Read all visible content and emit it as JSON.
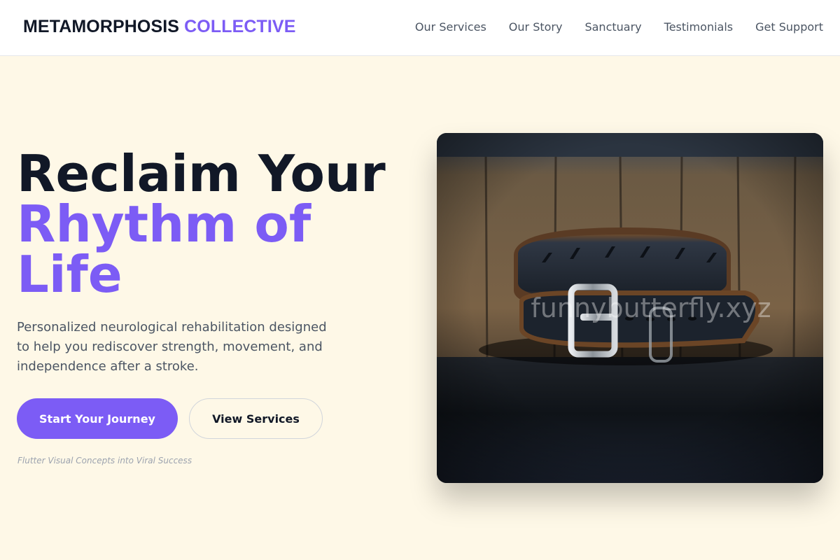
{
  "brand": {
    "part1": "METAMORPHOSIS",
    "part2": "COLLECTIVE"
  },
  "nav": {
    "items": [
      {
        "label": "Our Services"
      },
      {
        "label": "Our Story"
      },
      {
        "label": "Sanctuary"
      },
      {
        "label": "Testimonials"
      },
      {
        "label": "Get Support"
      }
    ]
  },
  "hero": {
    "title_line1": "Reclaim Your",
    "title_line2": "Rhythm of",
    "title_line3": "Life",
    "description": "Personalized neurological rehabilitation designed to help you rediscover strength, movement, and independence after a stroke.",
    "primary_button": "Start Your Journey",
    "secondary_button": "View Services",
    "tagline": "Flutter Visual Concepts into Viral Success",
    "image": {
      "subject": "leather-belt-photo",
      "watermark": "funnybutterfly.xyz"
    }
  },
  "colors": {
    "accent": "#7c5cf5",
    "background": "#fef8e7",
    "text_dark": "#111827",
    "text_muted": "#4b5563"
  }
}
